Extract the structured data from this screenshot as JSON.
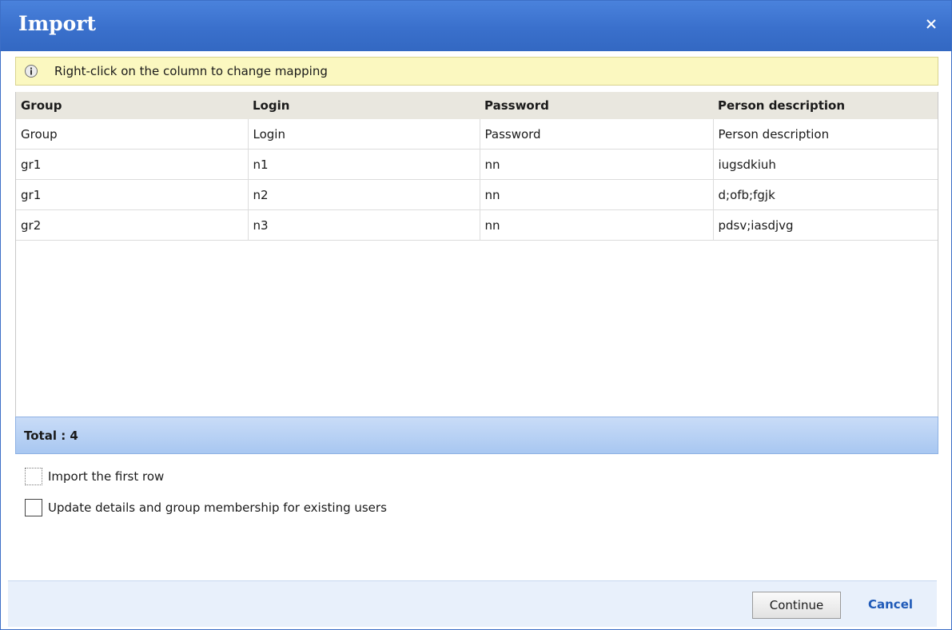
{
  "dialog": {
    "title": "Import",
    "close_icon": "close-icon"
  },
  "info": {
    "icon": "info-icon",
    "text": "Right-click on the column to change mapping"
  },
  "table": {
    "headers": [
      "Group",
      "Login",
      "Password",
      "Person description"
    ],
    "rows": [
      [
        "Group",
        "Login",
        "Password",
        "Person description"
      ],
      [
        "gr1",
        "n1",
        "nn",
        "iugsdkiuh"
      ],
      [
        "gr1",
        "n2",
        "nn",
        "d;ofb;fgjk"
      ],
      [
        "gr2",
        "n3",
        "nn",
        "pdsv;iasdjvg"
      ]
    ]
  },
  "total": {
    "label": "Total : 4"
  },
  "options": {
    "import_first_row": {
      "label": "Import the first row",
      "checked": false
    },
    "update_existing": {
      "label": "Update details and group membership for existing users",
      "checked": false
    }
  },
  "footer": {
    "continue_label": "Continue",
    "cancel_label": "Cancel"
  },
  "colors": {
    "titlebar": "#3a70cc",
    "info_bg": "#fbf8c0",
    "total_bar": "#a8c7f1",
    "cancel_link": "#1f5ab8"
  }
}
